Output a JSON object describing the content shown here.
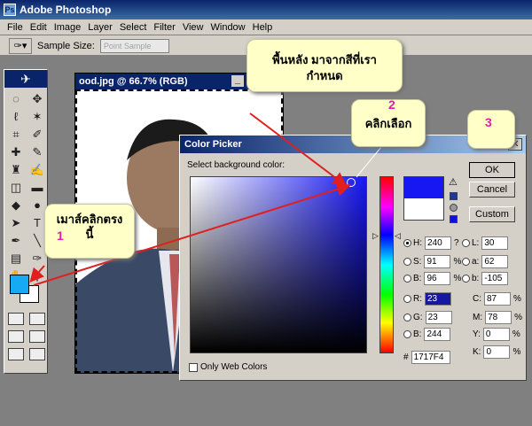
{
  "app": {
    "title": "Adobe Photoshop",
    "logo_icon": "photoshop-logo-icon"
  },
  "menu": [
    "File",
    "Edit",
    "Image",
    "Layer",
    "Select",
    "Filter",
    "View",
    "Window",
    "Help"
  ],
  "options_bar": {
    "sample_size_label": "Sample Size:",
    "sample_size_value": "Point Sample"
  },
  "document": {
    "title": "ood.jpg @ 66.7% (RGB)",
    "minimize_icon": "minimize-icon"
  },
  "toolbox": {
    "tools": [
      "marquee-icon",
      "move-icon",
      "lasso-icon",
      "magic-wand-icon",
      "crop-icon",
      "slice-icon",
      "healing-icon",
      "brush-icon",
      "stamp-icon",
      "history-brush-icon",
      "eraser-icon",
      "gradient-icon",
      "blur-icon",
      "dodge-icon",
      "path-select-icon",
      "type-icon",
      "pen-icon",
      "line-icon",
      "notes-icon",
      "eyedropper-icon",
      "hand-icon",
      "zoom-icon"
    ],
    "tool_glyphs": [
      "◌",
      "✥",
      "ℓ",
      "✶",
      "⌗",
      "✐",
      "✚",
      "✎",
      "♜",
      "✍",
      "◫",
      "▬",
      "◆",
      "●",
      "➤",
      "T",
      "✒",
      "╲",
      "▤",
      "✑",
      "✋",
      "🔍"
    ],
    "foreground_color": "#17aaf4",
    "background_color": "#ffffff"
  },
  "color_picker": {
    "title": "Color Picker",
    "prompt": "Select background color:",
    "buttons": {
      "ok": "OK",
      "cancel": "Cancel",
      "custom": "Custom"
    },
    "new_color": "#1717f4",
    "old_color": "#ffffff",
    "hsb": {
      "h": "240",
      "h_unit": "?",
      "s": "91",
      "s_unit": "%",
      "b": "96",
      "b_unit": "%"
    },
    "lab": {
      "l": "30",
      "a": "62",
      "b": "-105"
    },
    "rgb": {
      "r": "23",
      "g": "23",
      "b": "244"
    },
    "cmyk": {
      "c": "87",
      "m": "78",
      "y": "0",
      "k": "0",
      "unit": "%"
    },
    "labels": {
      "h": "H:",
      "s": "S:",
      "b": "B:",
      "l": "L:",
      "a": "a:",
      "bb": "b:",
      "r": "R:",
      "g": "G:",
      "blue": "B:",
      "c": "C:",
      "m": "M:",
      "y": "Y:",
      "k": "K:"
    },
    "hex_label": "#",
    "hex": "1717F4",
    "web_only": "Only Web Colors",
    "gamut_warning_icon": "warning-icon"
  },
  "annotations": {
    "bg_note_line1": "พื้นหลัง มาจากสีที่เรา",
    "bg_note_line2": "กำหนด",
    "click_note": "คลิกเลือก",
    "mouse_note_line1": "เมาส์คลิกตรง",
    "mouse_note_line2": "นี้",
    "step1": "1",
    "step2": "2",
    "step3": "3",
    "accent_color": "#e020a0",
    "arrow_color": "#e02020"
  }
}
